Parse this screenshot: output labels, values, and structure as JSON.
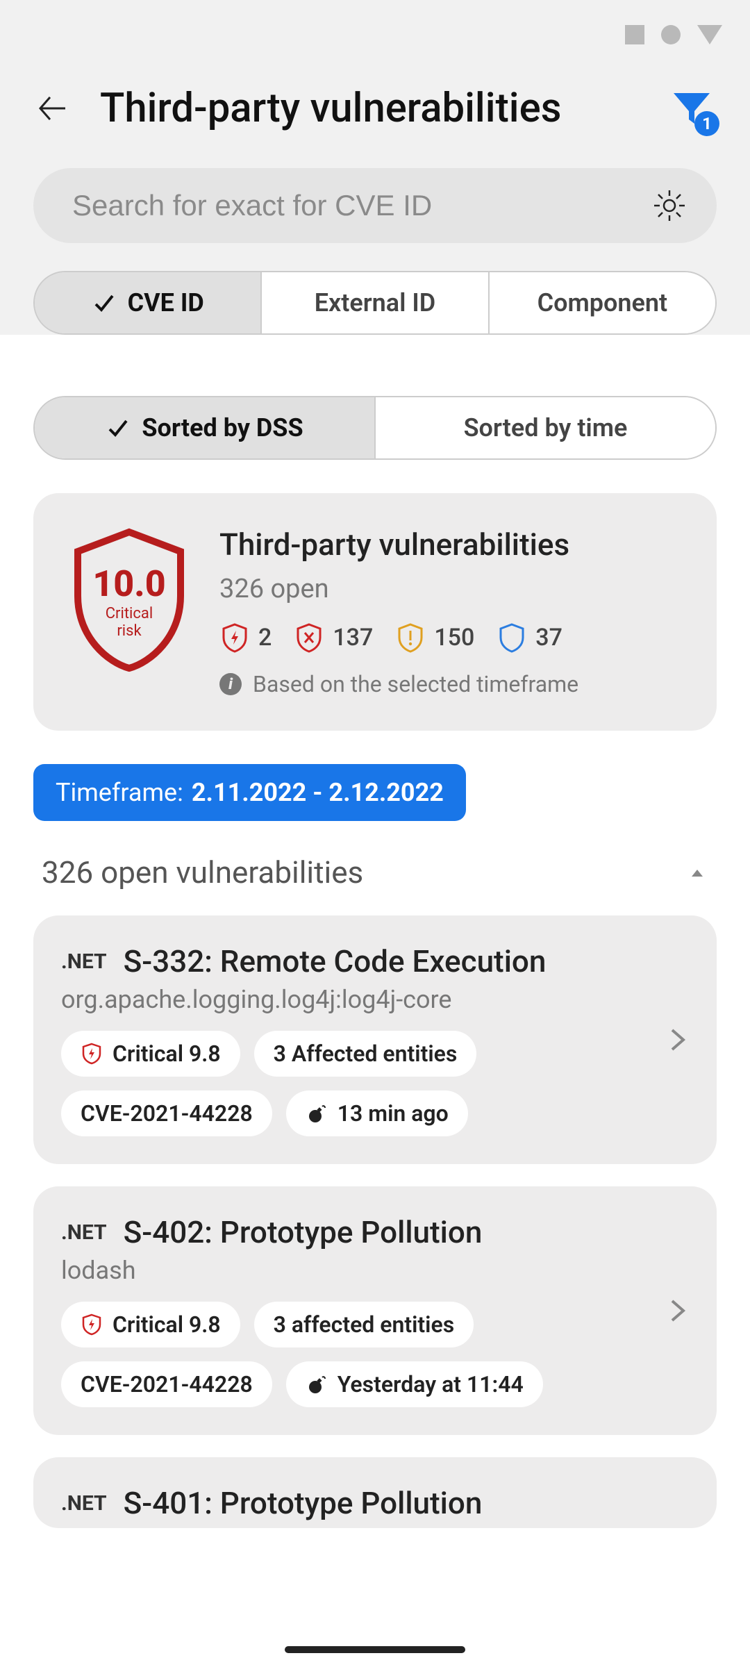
{
  "header": {
    "title": "Third-party vulnerabilities",
    "filter_count": "1"
  },
  "search": {
    "placeholder": "Search for exact for CVE ID"
  },
  "search_tabs": {
    "cve_id": "CVE ID",
    "external_id": "External ID",
    "component": "Component"
  },
  "sort_tabs": {
    "dss": "Sorted by DSS",
    "time": "Sorted by time"
  },
  "summary": {
    "title": "Third-party vulnerabilities",
    "open_text": "326 open",
    "score": "10.0",
    "risk_line1": "Critical",
    "risk_line2": "risk",
    "sev_critical": "2",
    "sev_high": "137",
    "sev_medium": "150",
    "sev_low": "37",
    "info_text": "Based on the selected timeframe"
  },
  "timeframe": {
    "label": "Timeframe:",
    "value": "2.11.2022 - 2.12.2022"
  },
  "list": {
    "header": "326 open vulnerabilities",
    "items": [
      {
        "tech": ".NET",
        "title": "S-332: Remote Code Execution",
        "subtitle": "org.apache.logging.log4j:log4j-core",
        "severity": "Critical 9.8",
        "affected": "3 Affected entities",
        "cve": "CVE-2021-44228",
        "time": "13 min ago"
      },
      {
        "tech": ".NET",
        "title": "S-402: Prototype Pollution",
        "subtitle": "lodash",
        "severity": "Critical 9.8",
        "affected": "3 affected entities",
        "cve": "CVE-2021-44228",
        "time": "Yesterday at 11:44"
      },
      {
        "tech": ".NET",
        "title": "S-401: Prototype Pollution",
        "subtitle": "",
        "severity": "",
        "affected": "",
        "cve": "",
        "time": ""
      }
    ]
  },
  "colors": {
    "accent_blue": "#1976e8",
    "critical_red": "#b61d1d",
    "high_red": "#cf2424",
    "medium_amber": "#e0a020",
    "low_blue": "#2b7de0"
  }
}
